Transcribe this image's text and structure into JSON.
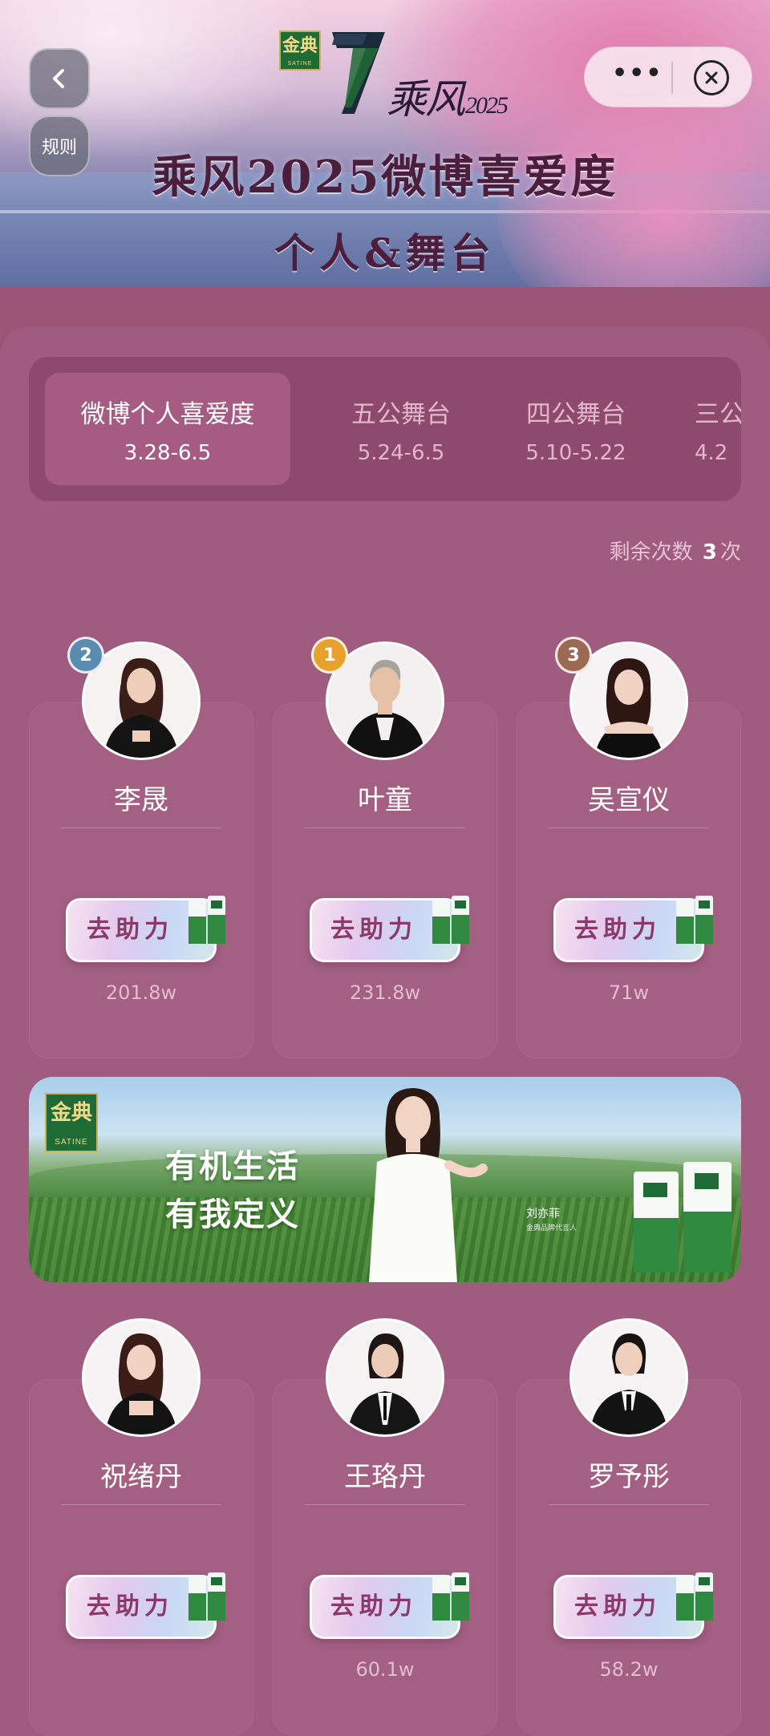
{
  "header": {
    "back_label": "<",
    "rules_label": "规则",
    "more_label": "•••",
    "logo_brand": "金典",
    "logo_brand_sub": "SATINE",
    "logo_show": "乘风",
    "logo_year": "2025",
    "title": "乘风2025微博喜爱度",
    "subtitle": "个人&舞台"
  },
  "tabs": [
    {
      "label": "微博个人喜爱度",
      "dates": "3.28-6.5",
      "active": true
    },
    {
      "label": "五公舞台",
      "dates": "5.24-6.5",
      "active": false
    },
    {
      "label": "四公舞台",
      "dates": "5.10-5.22",
      "active": false
    },
    {
      "label": "三公",
      "dates": "4.2",
      "active": false
    }
  ],
  "remaining": {
    "prefix": "剩余次数",
    "count": "3",
    "suffix": "次"
  },
  "help_label": "去助力",
  "contestants_row1": [
    {
      "name": "李晟",
      "votes": "201.8w",
      "rank": "2"
    },
    {
      "name": "叶童",
      "votes": "231.8w",
      "rank": "1"
    },
    {
      "name": "吴宣仪",
      "votes": "71w",
      "rank": "3"
    }
  ],
  "contestants_row2": [
    {
      "name": "祝绪丹",
      "votes": ""
    },
    {
      "name": "王珞丹",
      "votes": "60.1w"
    },
    {
      "name": "罗予彤",
      "votes": "58.2w"
    }
  ],
  "banner": {
    "brand": "金典",
    "brand_sub": "SATINE",
    "slogan_line1": "有机生活",
    "slogan_line2": "有我定义",
    "signature": "刘亦菲",
    "signature_sub": "金典品牌代言人"
  },
  "colors": {
    "page_bg": "#9a5577",
    "panel_bg": "#a05c7f",
    "tabs_bg": "#8e4a6c",
    "rank_gold": "#e8a22c",
    "rank_silver": "#5a8cb0",
    "rank_bronze": "#9c6a52",
    "brand_green": "#1f6b35"
  },
  "icons": [
    "chevron-left-icon",
    "more-dots-icon",
    "close-circle-icon",
    "milk-carton-icon"
  ]
}
